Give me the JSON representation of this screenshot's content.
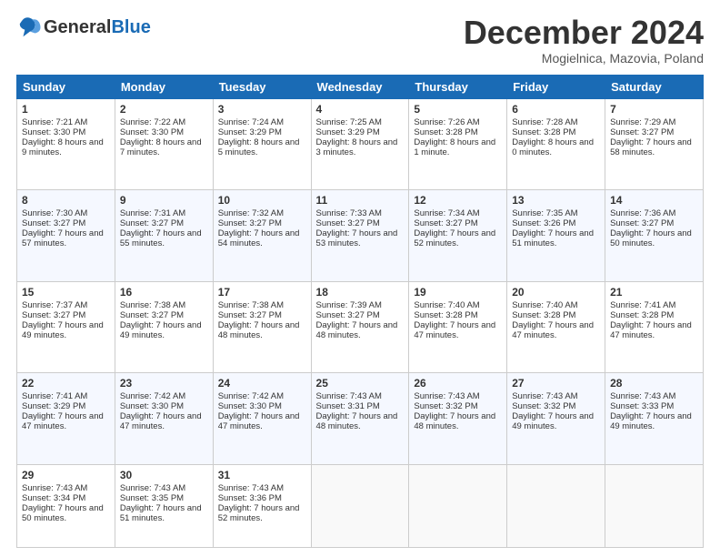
{
  "logo": {
    "general": "General",
    "blue": "Blue"
  },
  "header": {
    "month": "December 2024",
    "location": "Mogielnica, Mazovia, Poland"
  },
  "weekdays": [
    "Sunday",
    "Monday",
    "Tuesday",
    "Wednesday",
    "Thursday",
    "Friday",
    "Saturday"
  ],
  "weeks": [
    [
      {
        "day": "1",
        "sunrise": "Sunrise: 7:21 AM",
        "sunset": "Sunset: 3:30 PM",
        "daylight": "Daylight: 8 hours and 9 minutes."
      },
      {
        "day": "2",
        "sunrise": "Sunrise: 7:22 AM",
        "sunset": "Sunset: 3:30 PM",
        "daylight": "Daylight: 8 hours and 7 minutes."
      },
      {
        "day": "3",
        "sunrise": "Sunrise: 7:24 AM",
        "sunset": "Sunset: 3:29 PM",
        "daylight": "Daylight: 8 hours and 5 minutes."
      },
      {
        "day": "4",
        "sunrise": "Sunrise: 7:25 AM",
        "sunset": "Sunset: 3:29 PM",
        "daylight": "Daylight: 8 hours and 3 minutes."
      },
      {
        "day": "5",
        "sunrise": "Sunrise: 7:26 AM",
        "sunset": "Sunset: 3:28 PM",
        "daylight": "Daylight: 8 hours and 1 minute."
      },
      {
        "day": "6",
        "sunrise": "Sunrise: 7:28 AM",
        "sunset": "Sunset: 3:28 PM",
        "daylight": "Daylight: 8 hours and 0 minutes."
      },
      {
        "day": "7",
        "sunrise": "Sunrise: 7:29 AM",
        "sunset": "Sunset: 3:27 PM",
        "daylight": "Daylight: 7 hours and 58 minutes."
      }
    ],
    [
      {
        "day": "8",
        "sunrise": "Sunrise: 7:30 AM",
        "sunset": "Sunset: 3:27 PM",
        "daylight": "Daylight: 7 hours and 57 minutes."
      },
      {
        "day": "9",
        "sunrise": "Sunrise: 7:31 AM",
        "sunset": "Sunset: 3:27 PM",
        "daylight": "Daylight: 7 hours and 55 minutes."
      },
      {
        "day": "10",
        "sunrise": "Sunrise: 7:32 AM",
        "sunset": "Sunset: 3:27 PM",
        "daylight": "Daylight: 7 hours and 54 minutes."
      },
      {
        "day": "11",
        "sunrise": "Sunrise: 7:33 AM",
        "sunset": "Sunset: 3:27 PM",
        "daylight": "Daylight: 7 hours and 53 minutes."
      },
      {
        "day": "12",
        "sunrise": "Sunrise: 7:34 AM",
        "sunset": "Sunset: 3:27 PM",
        "daylight": "Daylight: 7 hours and 52 minutes."
      },
      {
        "day": "13",
        "sunrise": "Sunrise: 7:35 AM",
        "sunset": "Sunset: 3:26 PM",
        "daylight": "Daylight: 7 hours and 51 minutes."
      },
      {
        "day": "14",
        "sunrise": "Sunrise: 7:36 AM",
        "sunset": "Sunset: 3:27 PM",
        "daylight": "Daylight: 7 hours and 50 minutes."
      }
    ],
    [
      {
        "day": "15",
        "sunrise": "Sunrise: 7:37 AM",
        "sunset": "Sunset: 3:27 PM",
        "daylight": "Daylight: 7 hours and 49 minutes."
      },
      {
        "day": "16",
        "sunrise": "Sunrise: 7:38 AM",
        "sunset": "Sunset: 3:27 PM",
        "daylight": "Daylight: 7 hours and 49 minutes."
      },
      {
        "day": "17",
        "sunrise": "Sunrise: 7:38 AM",
        "sunset": "Sunset: 3:27 PM",
        "daylight": "Daylight: 7 hours and 48 minutes."
      },
      {
        "day": "18",
        "sunrise": "Sunrise: 7:39 AM",
        "sunset": "Sunset: 3:27 PM",
        "daylight": "Daylight: 7 hours and 48 minutes."
      },
      {
        "day": "19",
        "sunrise": "Sunrise: 7:40 AM",
        "sunset": "Sunset: 3:28 PM",
        "daylight": "Daylight: 7 hours and 47 minutes."
      },
      {
        "day": "20",
        "sunrise": "Sunrise: 7:40 AM",
        "sunset": "Sunset: 3:28 PM",
        "daylight": "Daylight: 7 hours and 47 minutes."
      },
      {
        "day": "21",
        "sunrise": "Sunrise: 7:41 AM",
        "sunset": "Sunset: 3:28 PM",
        "daylight": "Daylight: 7 hours and 47 minutes."
      }
    ],
    [
      {
        "day": "22",
        "sunrise": "Sunrise: 7:41 AM",
        "sunset": "Sunset: 3:29 PM",
        "daylight": "Daylight: 7 hours and 47 minutes."
      },
      {
        "day": "23",
        "sunrise": "Sunrise: 7:42 AM",
        "sunset": "Sunset: 3:30 PM",
        "daylight": "Daylight: 7 hours and 47 minutes."
      },
      {
        "day": "24",
        "sunrise": "Sunrise: 7:42 AM",
        "sunset": "Sunset: 3:30 PM",
        "daylight": "Daylight: 7 hours and 47 minutes."
      },
      {
        "day": "25",
        "sunrise": "Sunrise: 7:43 AM",
        "sunset": "Sunset: 3:31 PM",
        "daylight": "Daylight: 7 hours and 48 minutes."
      },
      {
        "day": "26",
        "sunrise": "Sunrise: 7:43 AM",
        "sunset": "Sunset: 3:32 PM",
        "daylight": "Daylight: 7 hours and 48 minutes."
      },
      {
        "day": "27",
        "sunrise": "Sunrise: 7:43 AM",
        "sunset": "Sunset: 3:32 PM",
        "daylight": "Daylight: 7 hours and 49 minutes."
      },
      {
        "day": "28",
        "sunrise": "Sunrise: 7:43 AM",
        "sunset": "Sunset: 3:33 PM",
        "daylight": "Daylight: 7 hours and 49 minutes."
      }
    ],
    [
      {
        "day": "29",
        "sunrise": "Sunrise: 7:43 AM",
        "sunset": "Sunset: 3:34 PM",
        "daylight": "Daylight: 7 hours and 50 minutes."
      },
      {
        "day": "30",
        "sunrise": "Sunrise: 7:43 AM",
        "sunset": "Sunset: 3:35 PM",
        "daylight": "Daylight: 7 hours and 51 minutes."
      },
      {
        "day": "31",
        "sunrise": "Sunrise: 7:43 AM",
        "sunset": "Sunset: 3:36 PM",
        "daylight": "Daylight: 7 hours and 52 minutes."
      },
      null,
      null,
      null,
      null
    ]
  ]
}
